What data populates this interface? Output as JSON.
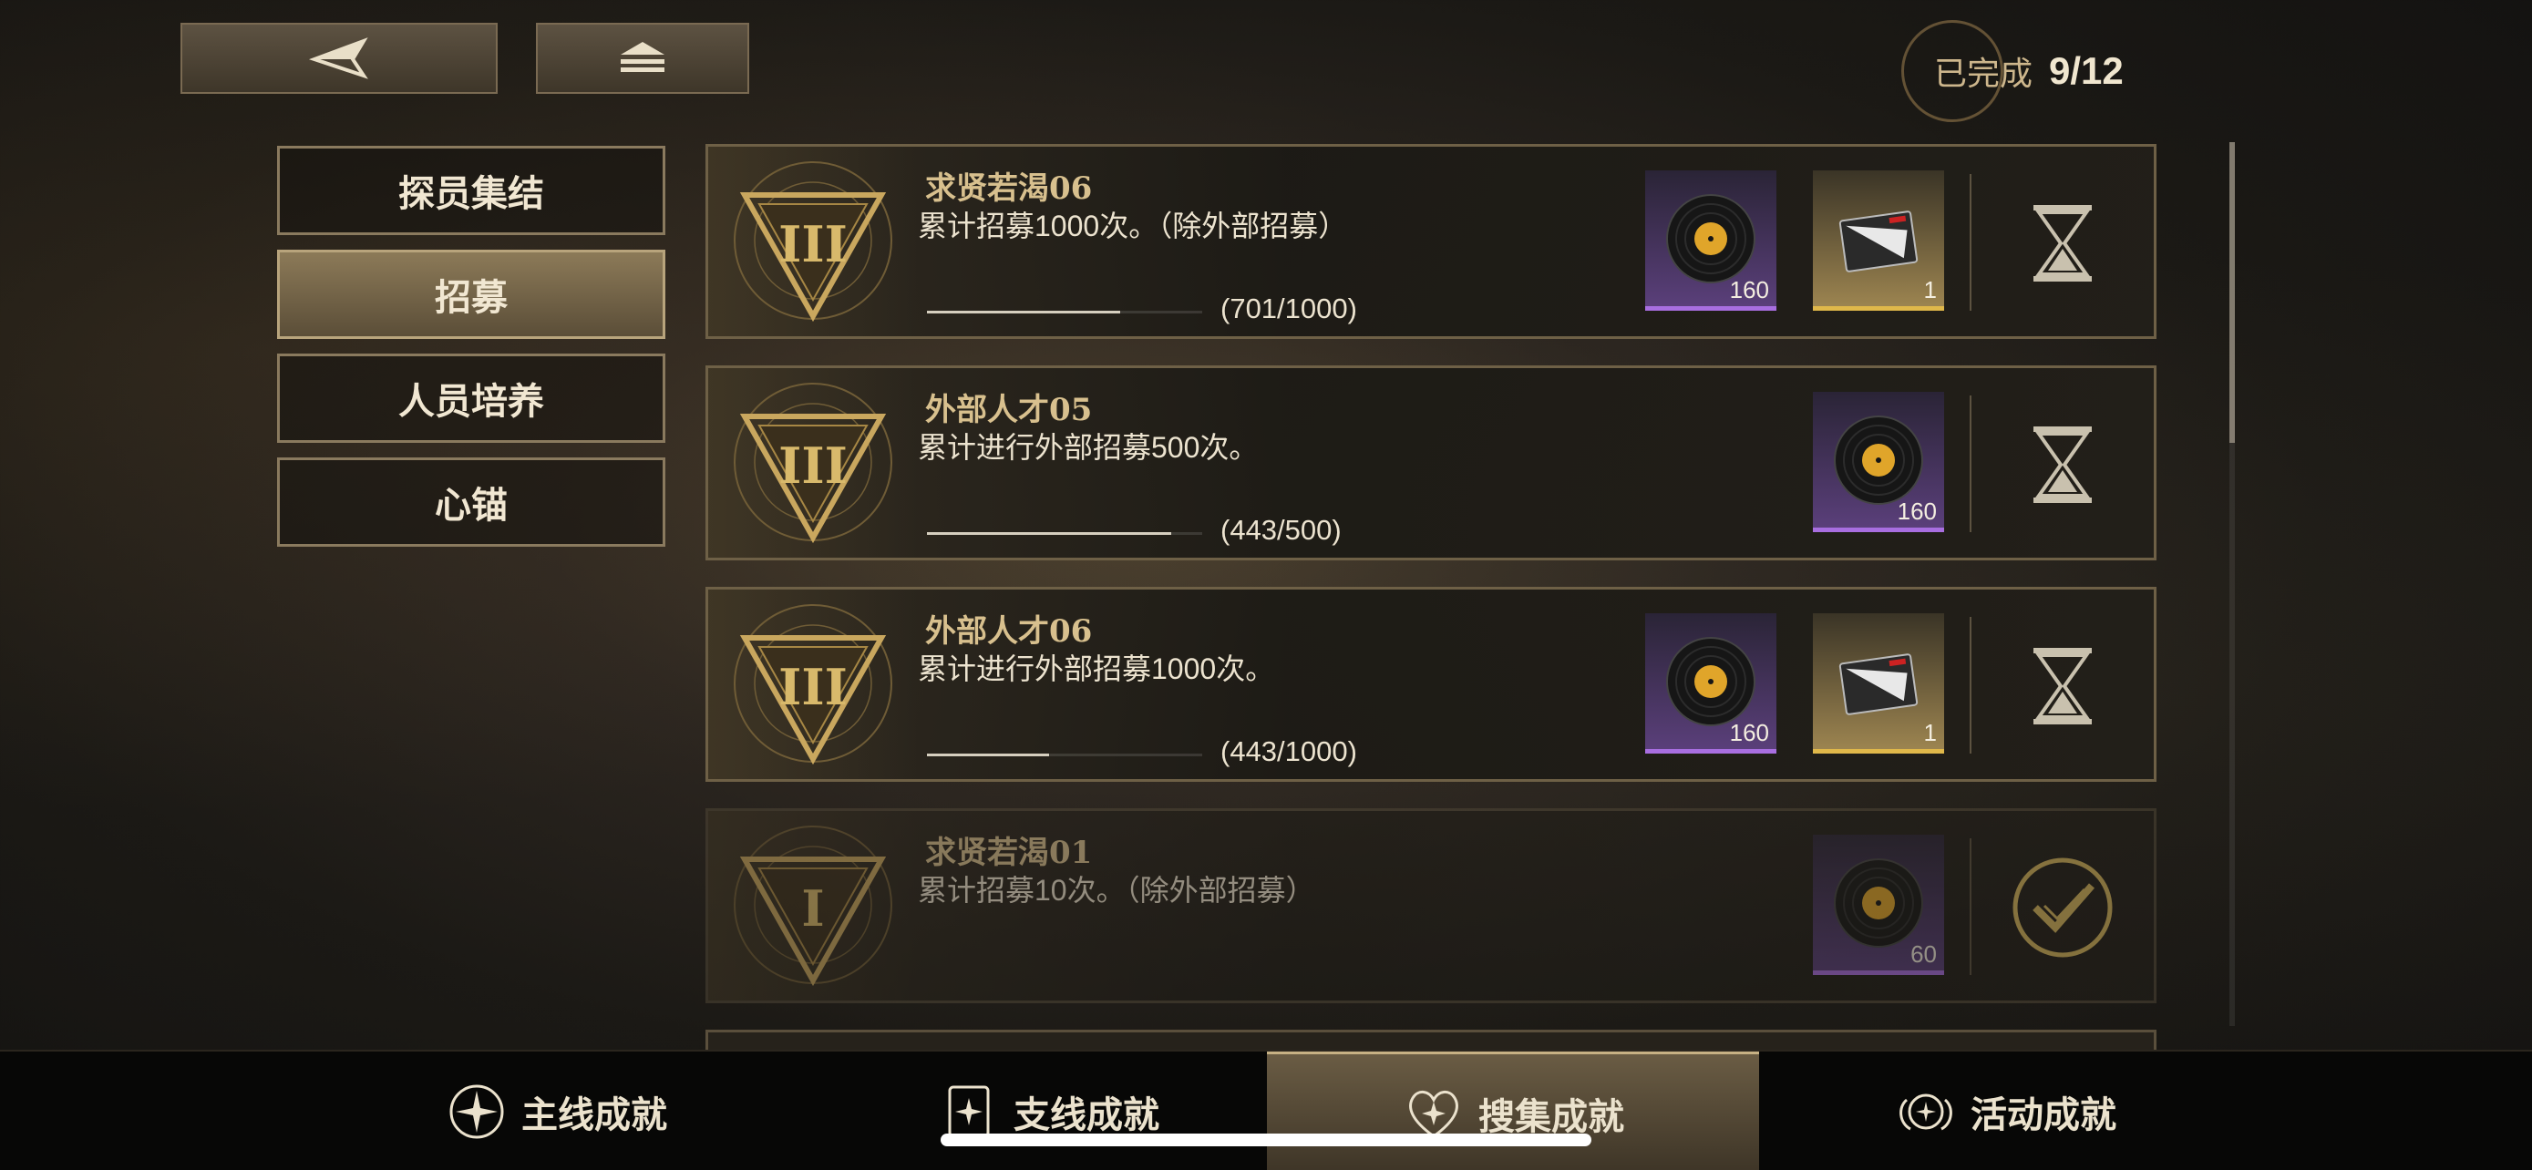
{
  "header": {
    "completion_label": "已完成",
    "completion_value": "9/12"
  },
  "categories": [
    {
      "label": "探员集结",
      "active": false
    },
    {
      "label": "招募",
      "active": true
    },
    {
      "label": "人员培养",
      "active": false
    },
    {
      "label": "心锚",
      "active": false
    }
  ],
  "achievements": [
    {
      "title": "求贤若渴06",
      "desc": "累计招募1000次。（除外部招募）",
      "progress": 0.701,
      "count": "(701/1000)",
      "rewards": [
        {
          "icon": "vinyl-record-icon",
          "rarity": "purple",
          "qty": "160"
        },
        {
          "icon": "ticket-card-icon",
          "rarity": "gold",
          "qty": "1"
        }
      ],
      "status": "in-progress",
      "tier": "III"
    },
    {
      "title": "外部人才05",
      "desc": "累计进行外部招募500次。",
      "progress": 0.886,
      "count": "(443/500)",
      "rewards": [
        {
          "icon": "vinyl-record-icon",
          "rarity": "purple",
          "qty": "160"
        }
      ],
      "status": "in-progress",
      "tier": "III"
    },
    {
      "title": "外部人才06",
      "desc": "累计进行外部招募1000次。",
      "progress": 0.443,
      "count": "(443/1000)",
      "rewards": [
        {
          "icon": "vinyl-record-icon",
          "rarity": "purple",
          "qty": "160"
        },
        {
          "icon": "ticket-card-icon",
          "rarity": "gold",
          "qty": "1"
        }
      ],
      "status": "in-progress",
      "tier": "III"
    },
    {
      "title": "求贤若渴01",
      "desc": "累计招募10次。（除外部招募）",
      "progress": 1.0,
      "count": "",
      "rewards": [
        {
          "icon": "vinyl-record-icon",
          "rarity": "purple",
          "qty": "60"
        }
      ],
      "status": "completed",
      "tier": "I"
    }
  ],
  "bottom_nav": [
    {
      "label": "主线成就",
      "icon": "compass-star-icon",
      "active": false
    },
    {
      "label": "支线成就",
      "icon": "card-star-icon",
      "active": false
    },
    {
      "label": "搜集成就",
      "icon": "heart-star-icon",
      "active": true
    },
    {
      "label": "活动成就",
      "icon": "wing-star-icon",
      "active": false
    }
  ],
  "colors": {
    "accent_gold": "#d8c08e",
    "rarity_purple": "#a86ee0",
    "rarity_gold": "#e0b84a"
  }
}
